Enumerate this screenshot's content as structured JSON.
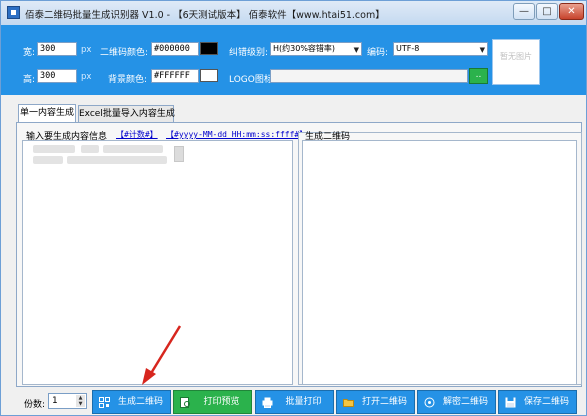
{
  "window": {
    "title": "佰泰二维码批量生成识别器 V1.0 - 【6天测试版本】 佰泰软件【www.htai51.com】",
    "min_label": "—",
    "max_label": "□",
    "close_label": "✕"
  },
  "settings": {
    "width_label": "宽:",
    "width_value": "300",
    "width_unit": "px",
    "height_label": "高:",
    "height_value": "300",
    "height_unit": "px",
    "qr_color_label": "二维码颜色:",
    "qr_color_value": "#000000",
    "qr_color_swatch": "#000000",
    "bg_color_label": "背景颜色:",
    "bg_color_value": "#FFFFFF",
    "bg_color_swatch": "#FFFFFF",
    "error_level_label": "纠错级别:",
    "error_level_value": "H(约30%容错率)",
    "encoding_label": "编码:",
    "encoding_value": "UTF-8",
    "logo_label": "LOGO图标:",
    "logo_browse": "..",
    "preview_text": "暂无图片"
  },
  "tabs": [
    {
      "label": "单一内容生成",
      "active": true
    },
    {
      "label": "Excel批量导入内容生成",
      "active": false
    }
  ],
  "input_pane": {
    "title": "输入要生成内容信息",
    "hint_counter": "【#计数#】",
    "hint_datetime": "【#yyyy-MM-dd HH:mm:ss:ffff#】"
  },
  "output_pane": {
    "title": "生成二维码"
  },
  "bottom": {
    "copies_label": "份数:",
    "copies_value": "1",
    "buttons": {
      "generate": "生成二维码",
      "print_preview": "打印预览",
      "batch_print": "批量打印",
      "open": "打开二维码",
      "decode": "解密二维码",
      "save": "保存二维码"
    }
  },
  "colors": {
    "accent_blue": "#2592e6",
    "accent_green": "#2bb24c",
    "arrow_red": "#d7261e"
  }
}
